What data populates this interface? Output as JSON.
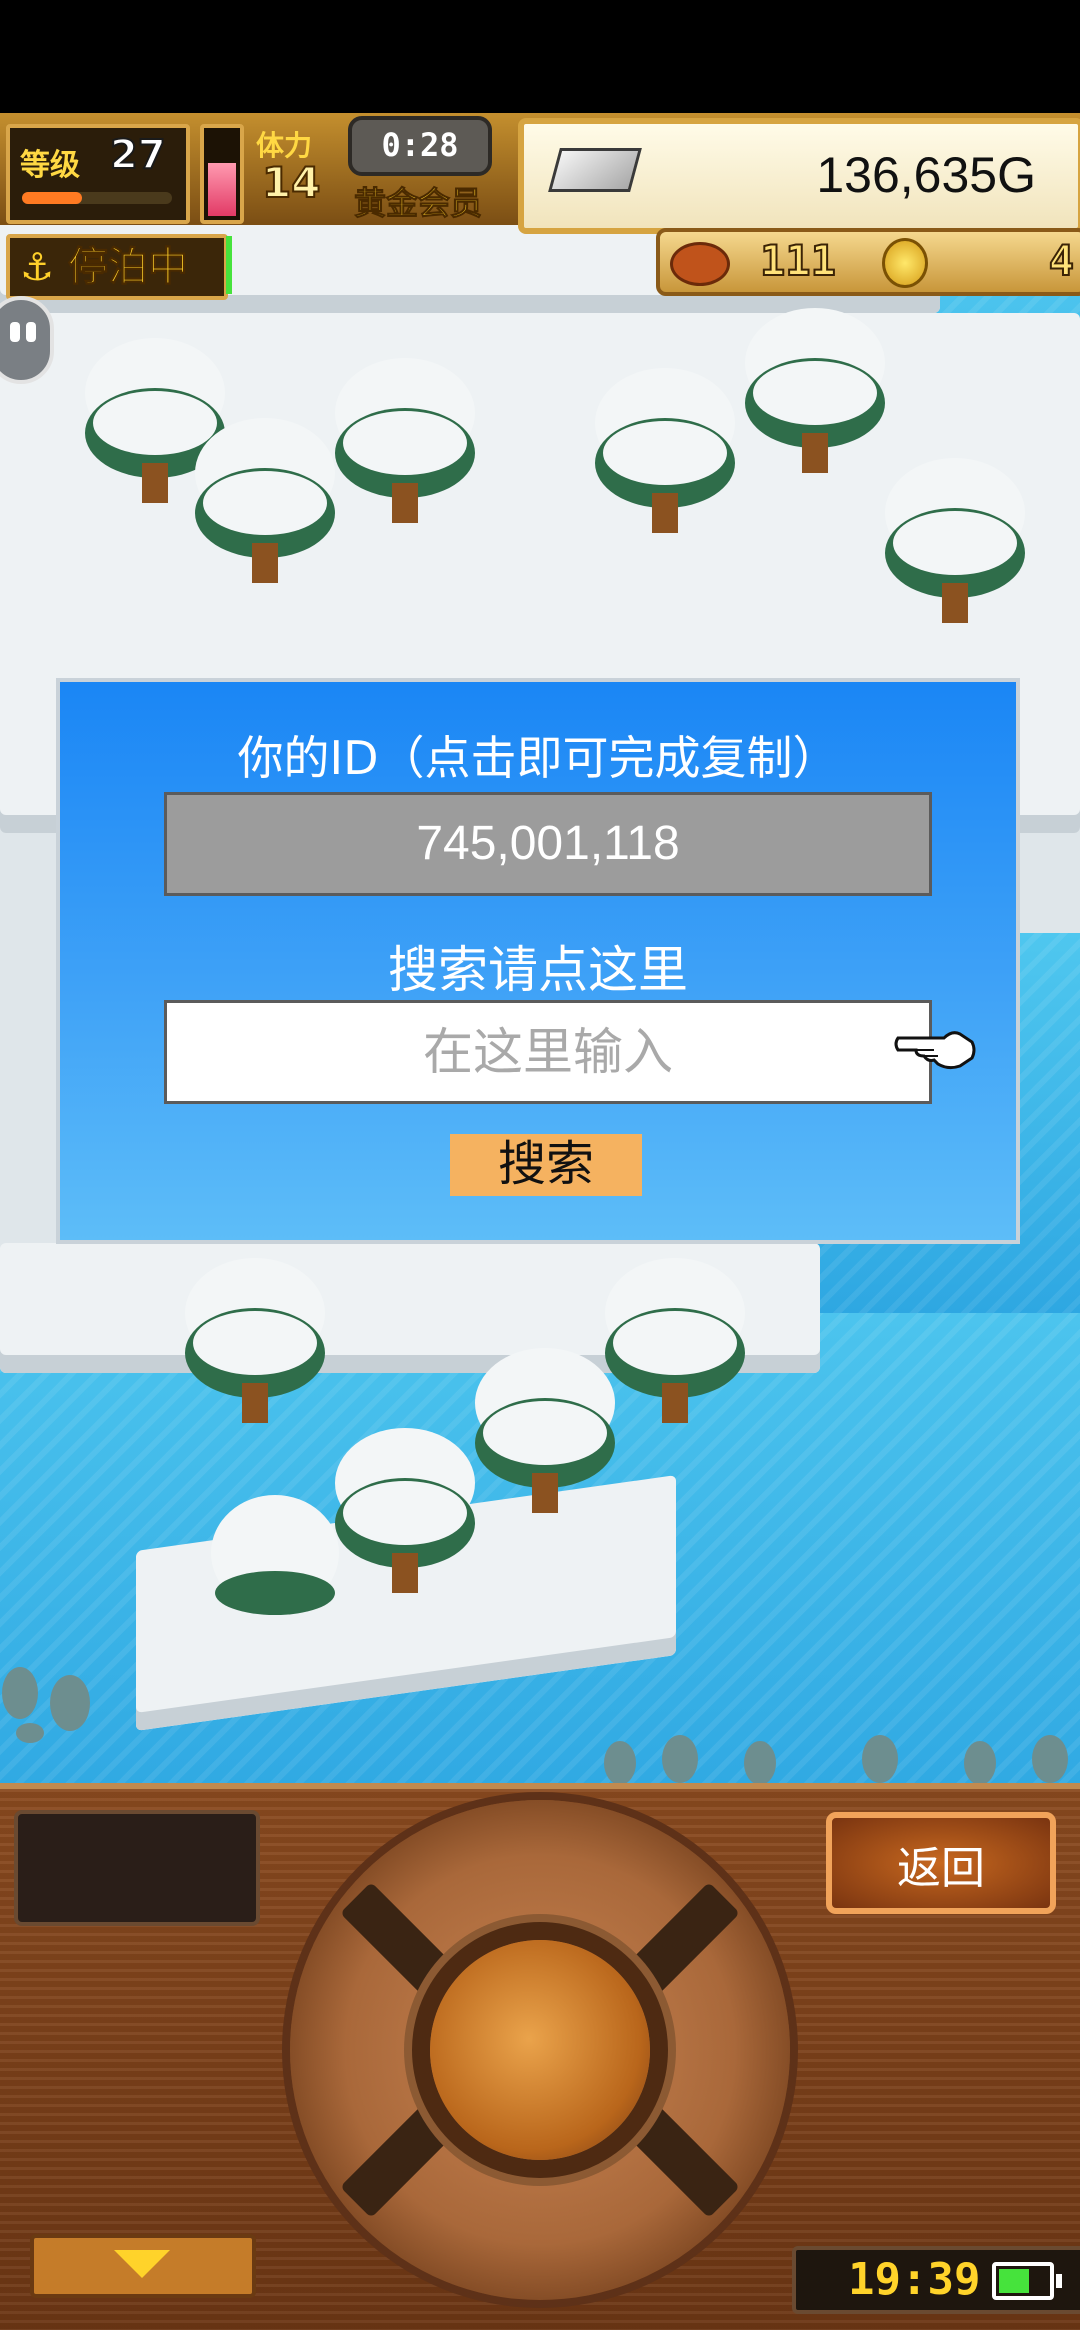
{
  "hud": {
    "level_label": "等级",
    "level": "27",
    "stamina_label": "体力",
    "stamina": "14",
    "timer": "0:28",
    "membership": "黄金会员",
    "gold": "136,635G",
    "dock_status": "停泊中",
    "food": "111",
    "coins": "4"
  },
  "dialog": {
    "title": "你的ID（点击即可完成复制）",
    "id_value": "745,001,118",
    "search_hint": "搜索请点这里",
    "search_placeholder": "在这里输入",
    "search_button": "搜索"
  },
  "controls": {
    "back_button": "返回",
    "clock": "19:39"
  },
  "icons": {
    "anchor": "anchor-icon",
    "silver": "silver-ingot-icon",
    "meat": "meat-icon",
    "coin": "coin-icon",
    "hand": "pointing-hand-icon",
    "down_arrow": "down-arrow-icon",
    "battery": "battery-icon"
  },
  "colors": {
    "dialog_top": "#1a86f5",
    "dialog_bottom": "#5dbdf8",
    "search_button": "#f5b260",
    "id_field": "#9c9c9c",
    "water": "#2ea7e2",
    "hud_gold": "#ffd02a"
  }
}
